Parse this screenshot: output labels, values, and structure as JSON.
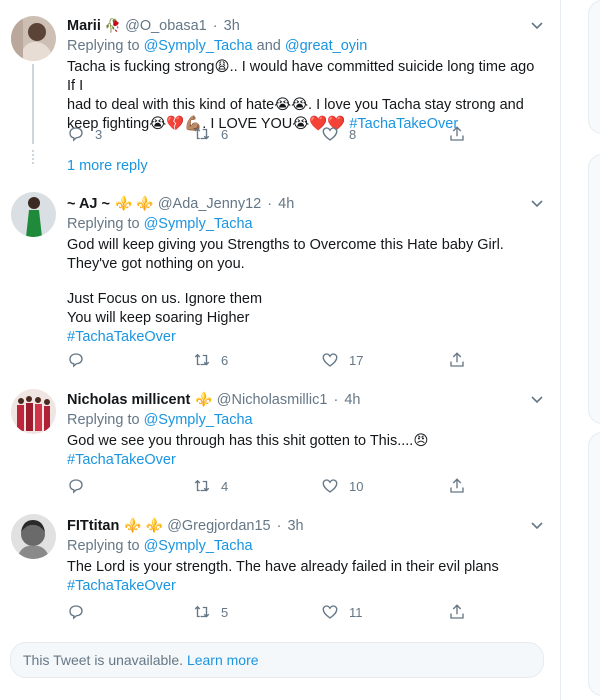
{
  "tweets": [
    {
      "display_name": "Marii",
      "name_emoji": "🥀",
      "handle": "@O_obasa1",
      "time": "3h",
      "replying_prefix": "Replying to",
      "replying_mentions": [
        "@Symply_Tacha",
        "@great_oyin"
      ],
      "replying_joiner": "and",
      "text_lines": [
        "Tacha is fucking strong😩.. I would have committed suicide long time ago If I",
        "had to deal with this kind of hate😭😭. I love you Tacha stay strong and",
        "keep fighting😭💔💪🏽. I LOVE YOU😭❤️❤️"
      ],
      "hashtag": "#TachaTakeOver",
      "replies": "3",
      "retweets": "6",
      "likes": "8",
      "more_reply": "1 more reply"
    },
    {
      "display_name": "~ AJ ~",
      "name_emoji": "⚜️ ⚜️",
      "handle": "@Ada_Jenny12",
      "time": "4h",
      "replying_prefix": "Replying to",
      "replying_mentions": [
        "@Symply_Tacha"
      ],
      "text_lines": [
        "God will keep giving you Strengths to Overcome this Hate baby Girl.",
        "They've got nothing on you.",
        "",
        "Just Focus on us. Ignore them",
        "You will keep soaring Higher"
      ],
      "hashtag": "#TachaTakeOver",
      "replies": "",
      "retweets": "6",
      "likes": "17"
    },
    {
      "display_name": "Nicholas millicent",
      "name_emoji": "⚜️",
      "handle": "@Nicholasmillic1",
      "time": "4h",
      "replying_prefix": "Replying to",
      "replying_mentions": [
        "@Symply_Tacha"
      ],
      "text_lines": [
        "God we see you through has this shit gotten to This....😠"
      ],
      "hashtag": "#TachaTakeOver",
      "replies": "",
      "retweets": "4",
      "likes": "10"
    },
    {
      "display_name": "FITtitan",
      "name_emoji": "⚜️ ⚜️",
      "handle": "@Gregjordan15",
      "time": "3h",
      "replying_prefix": "Replying to",
      "replying_mentions": [
        "@Symply_Tacha"
      ],
      "text_lines": [
        "The Lord is your strength. The have already failed in their evil plans"
      ],
      "hashtag": "#TachaTakeOver",
      "replies": "",
      "retweets": "5",
      "likes": "11"
    }
  ],
  "unavailable": {
    "text": "This Tweet is unavailable.",
    "link": "Learn more"
  },
  "icons": {
    "reply": "reply-icon",
    "retweet": "retweet-icon",
    "like": "heart-icon",
    "share": "share-icon",
    "caret": "chevron-down-icon"
  },
  "colors": {
    "link": "#1b95e0",
    "secondary_text": "#657786",
    "border": "#e6ecf0"
  }
}
